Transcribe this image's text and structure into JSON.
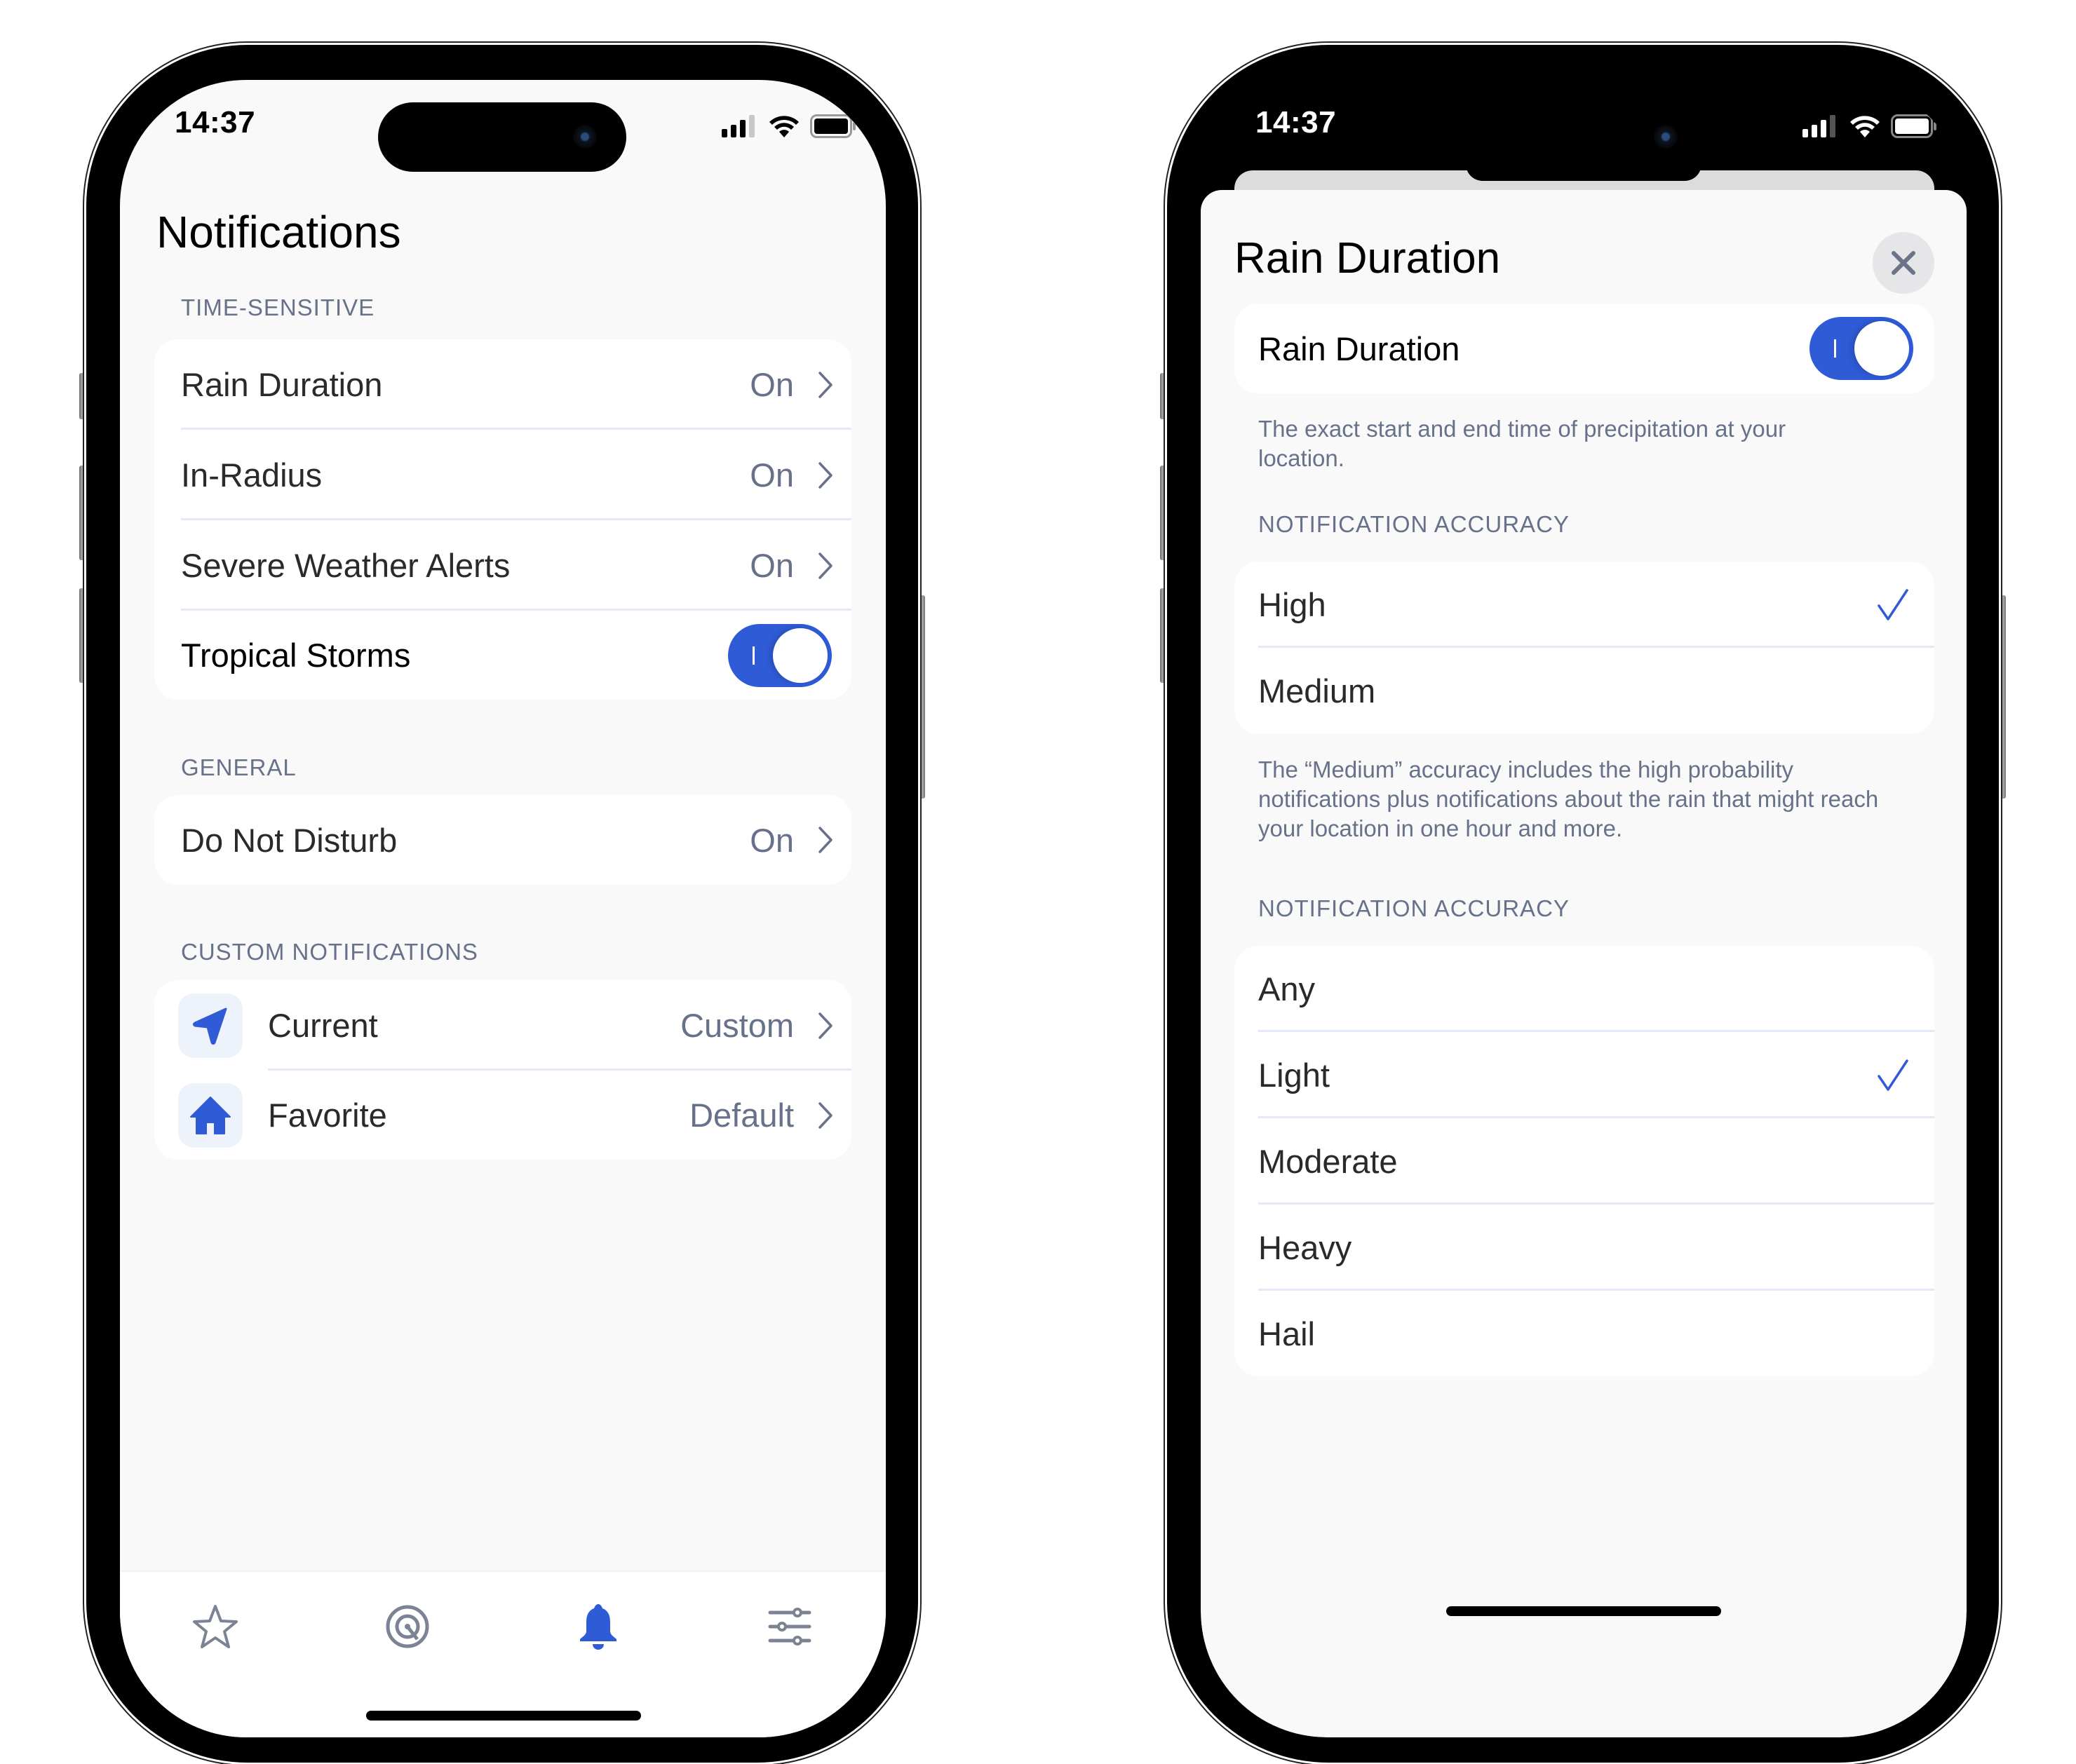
{
  "left_screen": {
    "status_bar": {
      "time": "14:37",
      "icons": [
        "signal-icon",
        "wifi-icon",
        "battery-icon"
      ]
    },
    "title": "Notifications",
    "sections": [
      {
        "header": "TIME-SENSITIVE",
        "rows": [
          {
            "label": "Rain Duration",
            "value": "On",
            "type": "disclosure"
          },
          {
            "label": "In-Radius",
            "value": "On",
            "type": "disclosure"
          },
          {
            "label": "Severe Weather Alerts",
            "value": "On",
            "type": "disclosure"
          },
          {
            "label": "Tropical Storms",
            "type": "toggle",
            "toggle_on": true
          }
        ]
      },
      {
        "header": "GENERAL",
        "rows": [
          {
            "label": "Do Not Disturb",
            "value": "On",
            "type": "disclosure"
          }
        ]
      },
      {
        "header": "CUSTOM NOTIFICATIONS",
        "rows": [
          {
            "icon": "location-arrow-icon",
            "label": "Current",
            "value": "Custom",
            "type": "disclosure"
          },
          {
            "icon": "home-icon",
            "label": "Favorite",
            "value": "Default",
            "type": "disclosure"
          }
        ]
      }
    ],
    "tab_bar": [
      {
        "icon": "star-icon",
        "active": false
      },
      {
        "icon": "radar-icon",
        "active": false
      },
      {
        "icon": "bell-icon",
        "active": true
      },
      {
        "icon": "sliders-icon",
        "active": false
      }
    ]
  },
  "right_screen": {
    "status_bar": {
      "time": "14:37",
      "icons": [
        "signal-icon",
        "wifi-icon",
        "battery-icon"
      ]
    },
    "sheet": {
      "title": "Rain Duration",
      "close_icon": "close-icon",
      "toggle_row": {
        "label": "Rain Duration",
        "toggle_on": true
      },
      "toggle_description": "The exact start and end time of precipitation at your location.",
      "accuracy_header": "NOTIFICATION ACCURACY",
      "accuracy_options": [
        {
          "label": "High",
          "selected": true
        },
        {
          "label": "Medium",
          "selected": false
        }
      ],
      "accuracy_description": "The “Medium” accuracy includes the high probability notifications plus notifications about the rain that might reach your location in one hour and more.",
      "intensity_header": "NOTIFICATION ACCURACY",
      "intensity_options": [
        {
          "label": "Any",
          "selected": false
        },
        {
          "label": "Light",
          "selected": true
        },
        {
          "label": "Moderate",
          "selected": false
        },
        {
          "label": "Heavy",
          "selected": false
        },
        {
          "label": "Hail",
          "selected": false
        }
      ]
    }
  },
  "colors": {
    "accent": "#2f5bd6",
    "secondary_text": "#67718a",
    "background": "#f9f9f9",
    "card": "#ffffff",
    "separator": "#e3e9f6"
  }
}
